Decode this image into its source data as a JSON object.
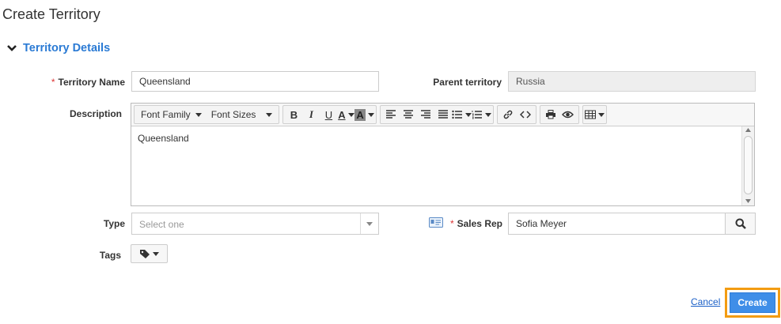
{
  "page": {
    "title": "Create Territory"
  },
  "section": {
    "title": "Territory Details"
  },
  "form": {
    "territory_name": {
      "label": "Territory Name",
      "value": "Queensland"
    },
    "parent_territory": {
      "label": "Parent territory",
      "value": "Russia"
    },
    "description": {
      "label": "Description",
      "content": "Queensland",
      "toolbar": {
        "font_family": "Font Family",
        "font_sizes": "Font Sizes"
      }
    },
    "type": {
      "label": "Type",
      "placeholder": "Select one"
    },
    "sales_rep": {
      "label": "Sales Rep",
      "value": "Sofia Meyer"
    },
    "tags": {
      "label": "Tags"
    }
  },
  "actions": {
    "cancel": "Cancel",
    "create": "Create"
  },
  "required_mark": "*",
  "colors": {
    "accent": "#3f8ee8",
    "section": "#2a7ad4",
    "highlight": "#f39c12",
    "required": "#d33"
  }
}
